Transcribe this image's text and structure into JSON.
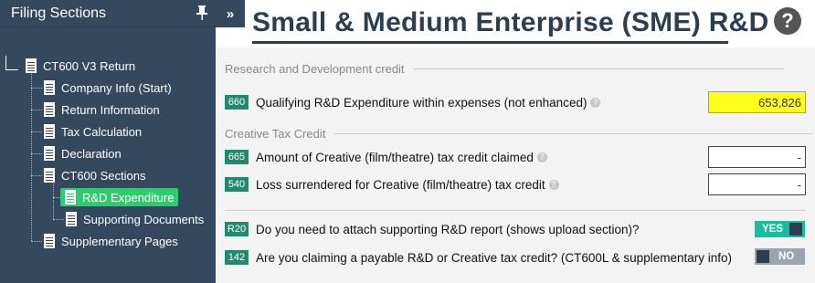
{
  "sidebar": {
    "title": "Filing Sections",
    "collapse_glyph": "»",
    "pin_icon": "pin-icon",
    "tree": {
      "root": "CT600 V3 Return",
      "items": [
        {
          "label": "Company Info (Start)"
        },
        {
          "label": "Return Information"
        },
        {
          "label": "Tax Calculation"
        },
        {
          "label": "Declaration"
        },
        {
          "label": "CT600 Sections"
        },
        {
          "label": "R&D Expenditure",
          "active": true
        },
        {
          "label": "Supporting Documents"
        },
        {
          "label": "Supplementary Pages"
        }
      ]
    }
  },
  "page": {
    "title": "Small & Medium Enterprise (SME) R&D",
    "help_glyph": "?"
  },
  "sections": {
    "rd": {
      "heading": "Research and Development credit",
      "row": {
        "box": "660",
        "label": "Qualifying R&D Expenditure within expenses (not enhanced)",
        "value": "653,826"
      }
    },
    "creative": {
      "heading": "Creative Tax Credit",
      "rows": [
        {
          "box": "665",
          "label": "Amount of Creative (film/theatre) tax credit claimed",
          "value": "-"
        },
        {
          "box": "540",
          "label": "Loss surrendered for Creative (film/theatre) tax credit",
          "value": "-"
        }
      ]
    },
    "questions": [
      {
        "box": "R20",
        "label": "Do you need to attach supporting R&D report (shows upload section)?",
        "toggle": "YES"
      },
      {
        "box": "142",
        "label": "Are you claiming a payable R&D or Creative tax credit? (CT600L & supplementary info)",
        "toggle": "NO"
      }
    ]
  },
  "help_mark": "?",
  "colors": {
    "sidebar_bg": "#34495e",
    "active_item": "#2ecc71",
    "box_badge": "#1e8a6e",
    "highlight": "#ffff1a",
    "toggle_on": "#1abc9c"
  }
}
